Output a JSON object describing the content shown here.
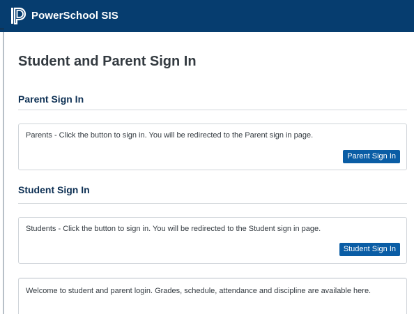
{
  "header": {
    "brand": "PowerSchool SIS",
    "logo_icon": "powerschool-logo-icon",
    "background_color": "#063d6f"
  },
  "main": {
    "title": "Student and Parent Sign In",
    "parent_section": {
      "heading": "Parent Sign In",
      "message": "Parents - Click the button to sign in. You will be redirected to the Parent sign in page.",
      "button_label": "Parent Sign In"
    },
    "student_section": {
      "heading": "Student Sign In",
      "message": "Students - Click the button to sign in. You will be redirected to the Student sign in page.",
      "button_label": "Student Sign In"
    },
    "welcome_message": "Welcome to student and parent login. Grades, schedule, attendance and discipline are available here."
  },
  "colors": {
    "accent": "#0a5da5",
    "heading": "#0c2f53",
    "text": "#333a40"
  }
}
